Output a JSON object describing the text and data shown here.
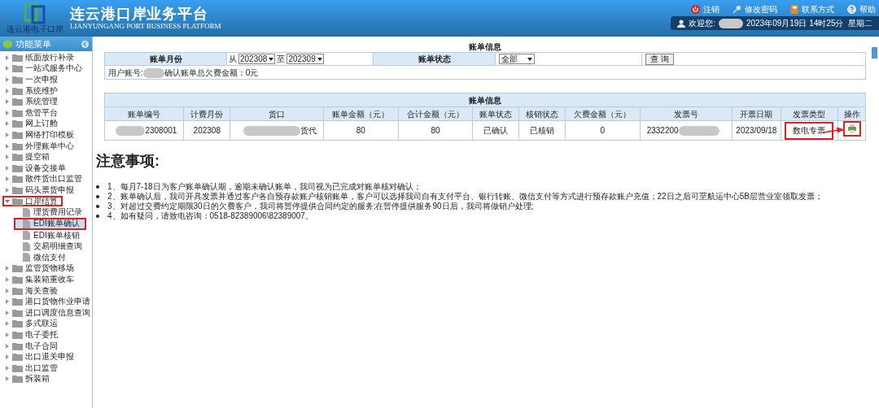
{
  "header": {
    "title": "连云港口岸业务平台",
    "subtitle": "LIANYUNGANG PORT BUSINESS PLATFORM",
    "logo_caption": "连云港电子口岸",
    "links": [
      {
        "kind": "logout",
        "label": "注销"
      },
      {
        "kind": "password",
        "label": "修改密码"
      },
      {
        "kind": "contact",
        "label": "联系方式"
      },
      {
        "kind": "help",
        "label": "帮助"
      }
    ],
    "welcome": "欢迎您:",
    "datetime": "2023年09月19日 14时25分  星期二"
  },
  "sidebar": {
    "title": "功能菜单",
    "items": [
      {
        "label": "纸面放行补录",
        "expanded": false,
        "marked": false
      },
      {
        "label": "一站式服务中心",
        "expanded": false,
        "marked": false
      },
      {
        "label": "一次申报",
        "expanded": false,
        "marked": false
      },
      {
        "label": "系统维护",
        "expanded": false,
        "marked": false
      },
      {
        "label": "系统管理",
        "expanded": false,
        "marked": false
      },
      {
        "label": "危管平台",
        "expanded": false,
        "marked": false
      },
      {
        "label": "网上订舱",
        "expanded": false,
        "marked": false
      },
      {
        "label": "网络打印模板",
        "expanded": false,
        "marked": false
      },
      {
        "label": "外理账单中心",
        "expanded": false,
        "marked": false
      },
      {
        "label": "提空箱",
        "expanded": false,
        "marked": false
      },
      {
        "label": "设备交接单",
        "expanded": false,
        "marked": false
      },
      {
        "label": "散件货出口监管",
        "expanded": false,
        "marked": false
      },
      {
        "label": "码头票货申报",
        "expanded": false,
        "marked": false
      },
      {
        "label": "口岸结算",
        "expanded": true,
        "marked": true,
        "children": [
          {
            "label": "理货费用记录",
            "selected": false,
            "marked": false
          },
          {
            "label": "EDI账单确认",
            "selected": true,
            "marked": true
          },
          {
            "label": "EDI账单核销",
            "selected": false,
            "marked": false
          },
          {
            "label": "交易明细查询",
            "selected": false,
            "marked": false
          },
          {
            "label": "微信支付",
            "selected": false,
            "marked": false
          }
        ]
      },
      {
        "label": "监管货物移场",
        "expanded": false,
        "marked": false
      },
      {
        "label": "集装箱重收车",
        "expanded": false,
        "marked": false
      },
      {
        "label": "海关查验",
        "expanded": false,
        "marked": false
      },
      {
        "label": "港口货物作业申请",
        "expanded": false,
        "marked": false
      },
      {
        "label": "进口调度信息查询",
        "expanded": false,
        "marked": false
      },
      {
        "label": "多式联运",
        "expanded": false,
        "marked": false
      },
      {
        "label": "电子委托",
        "expanded": false,
        "marked": false
      },
      {
        "label": "电子合同",
        "expanded": false,
        "marked": false
      },
      {
        "label": "出口退关申报",
        "expanded": false,
        "marked": false
      },
      {
        "label": "出口监管",
        "expanded": false,
        "marked": false
      },
      {
        "label": "拆装箱",
        "expanded": false,
        "marked": false
      }
    ]
  },
  "filter": {
    "title": "账单信息",
    "month_label": "账单月份",
    "from_label": "从",
    "from": "202308",
    "to_label": "至",
    "to": "202309",
    "status_label": "账单状态",
    "status": "全部",
    "query_button": "查 询",
    "account_label": "用户账号:",
    "summary": "确认账单总欠费金额：0元"
  },
  "table": {
    "title": "账单信息",
    "columns": [
      "账单编号",
      "计费月份",
      "货口",
      "账单金额（元）",
      "合计金额（元）",
      "账单状态",
      "核销状态",
      "欠费金额（元）",
      "发票号",
      "开票日期",
      "发票类型",
      "操作"
    ],
    "rows": [
      {
        "cells": [
          "2308001",
          "202308",
          "货代",
          "80",
          "80",
          "已确认",
          "已核销",
          "0",
          "2332200",
          "2023/09/18",
          "数电专票"
        ],
        "marked_invoice_type": true
      }
    ]
  },
  "notes": {
    "title": "注意事项:",
    "items": [
      "1、每月7-18日为客户账单确认期，逾期未确认账单，我司视为已完成对账单核对确认；",
      "2、账单确认后，我司开具发票并通过客户各自预存款账户核销账单，客户可以选择我司自有支付平台、银行转账、微信支付等方式进行预存款账户充值；22日之后可至航运中心5B层营业室领取发票；",
      "3、对超过交费约定期限30日的欠费客户，我司将暂停提供合同约定的服务;在暂停提供服务90日后，我司将做销户处理;",
      "4、如有疑问，请致电咨询：0518-82389006\\82389007。"
    ]
  }
}
